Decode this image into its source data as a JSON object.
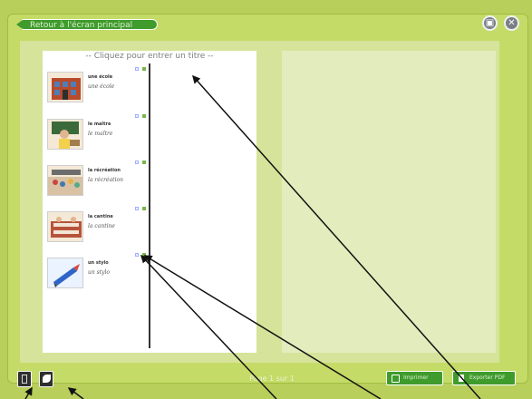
{
  "header": {
    "back_label": "Retour à l'écran principal"
  },
  "title_placeholder": "-- Cliquez pour entrer un titre --",
  "cards": [
    {
      "word": "une école",
      "script": "une école"
    },
    {
      "word": "le maître",
      "script": "le maître"
    },
    {
      "word": "la récréation",
      "script": "la récréation"
    },
    {
      "word": "la cantine",
      "script": "la cantine"
    },
    {
      "word": "un stylo",
      "script": "un stylo"
    }
  ],
  "footer": {
    "page_indicator": "Page 1 sur 1",
    "print_label": "Imprimer",
    "export_label": "Exporter PDF"
  }
}
